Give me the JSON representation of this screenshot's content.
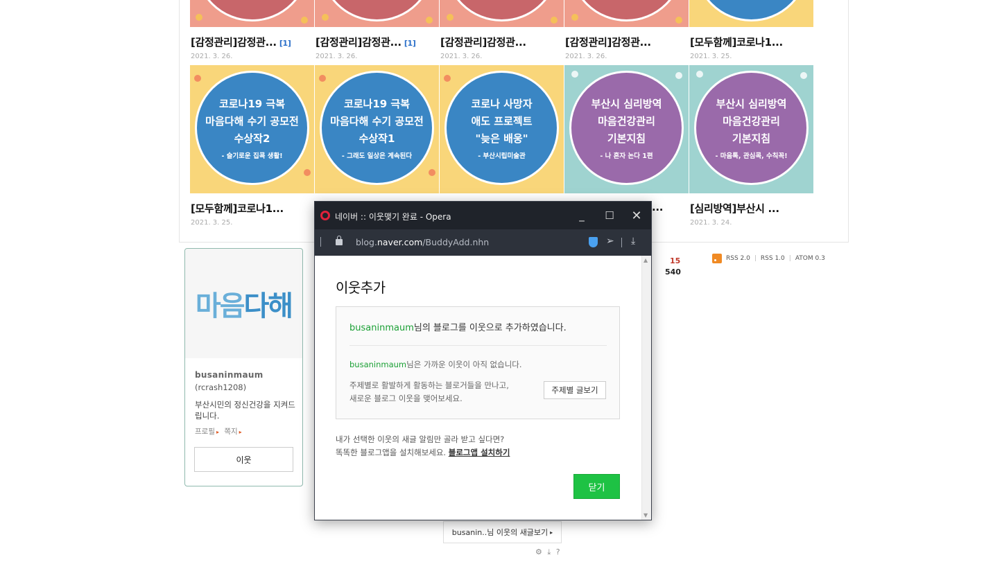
{
  "gallery": {
    "row1": [
      {
        "title": "[감정관리]감정관...",
        "badge": "[1]",
        "date": "2021. 3. 26."
      },
      {
        "title": "[감정관리]감정관...",
        "badge": "[1]",
        "date": "2021. 3. 26."
      },
      {
        "title": "[감정관리]감정관...",
        "badge": "",
        "date": "2021. 3. 26."
      },
      {
        "title": "[감정관리]감정관...",
        "badge": "",
        "date": "2021. 3. 26."
      },
      {
        "title": "[모두함께]코로나1...",
        "badge": "",
        "date": "2021. 3. 25."
      }
    ],
    "row2_images": [
      {
        "lines": [
          "코로나19 극복",
          "마음다해 수기 공모전",
          "수상작2"
        ],
        "sub": "- 슬기로운 집콕 생활!"
      },
      {
        "lines": [
          "코로나19 극복",
          "마음다해 수기 공모전",
          "수상작1"
        ],
        "sub": "- 그래도 일상은 계속된다"
      },
      {
        "lines": [
          "코로나 사망자",
          "애도 프로젝트",
          "\"늦은 배웅\""
        ],
        "sub": "- 부산시립미술관"
      },
      {
        "lines": [
          "부산시 심리방역",
          "마음건강관리",
          "기본지침"
        ],
        "sub": "- 나 혼자 논다 1편"
      },
      {
        "lines": [
          "부산시 심리방역",
          "마음건강관리",
          "기본지침"
        ],
        "sub": "- 마음톡, 관심콕, 수칙꼭!"
      }
    ],
    "row2": [
      {
        "title": "[모두함께]코로나1...",
        "date": "2021. 3. 25."
      },
      {
        "title": "[심리방역]부산시 ...",
        "date": "2021. 3. 24."
      }
    ],
    "row2_partial_title": "..."
  },
  "profile": {
    "logo_text_a": "마음",
    "logo_text_b": "다해",
    "id": "busaninmaum",
    "sub_id": "(rcrash1208)",
    "description": "부산시민의 정신건강을 지켜드립니다.",
    "link_profile": "프로필",
    "link_message": "쪽지",
    "buddy_button": "이웃"
  },
  "counter": {
    "today": "15",
    "total": "540"
  },
  "rss": {
    "rss2": "RSS 2.0",
    "rss1": "RSS 1.0",
    "atom": "ATOM 0.3"
  },
  "bottom": {
    "newpost": "busanin..님 이웃의 새글보기",
    "tools": "⚙ ⤓ ?"
  },
  "popup": {
    "window_title": "네이버 :: 이웃맺기 완료 - Opera",
    "url_host": "blog.",
    "url_domain": "naver.com",
    "url_path": "/BuddyAdd.nhn",
    "dialog_title": "이웃추가",
    "line1_user": "busaninmaum",
    "line1_rest": "님의 블로그를 이웃으로 추가하였습니다.",
    "line2_user": "busaninmaum",
    "line2_rest": "님은 가까운 이웃이 아직 없습니다.",
    "line3a": "주제별로 활발하게 활동하는 블로거들을 만나고,",
    "line3b": "새로운 블로그 이웃을 맺어보세요.",
    "topic_button": "주제별 글보기",
    "foot1": "내가 선택한 이웃의 새글 알림만 골라 받고 싶다면?",
    "foot2": "똑똑한 블로그앱을 설치해보세요.",
    "foot_link": "블로그앱 설치하기",
    "close_button": "닫기"
  },
  "colors": {
    "accent_green": "#1ec244",
    "naver_green": "#1ba035",
    "title_bar": "#1f232a"
  }
}
